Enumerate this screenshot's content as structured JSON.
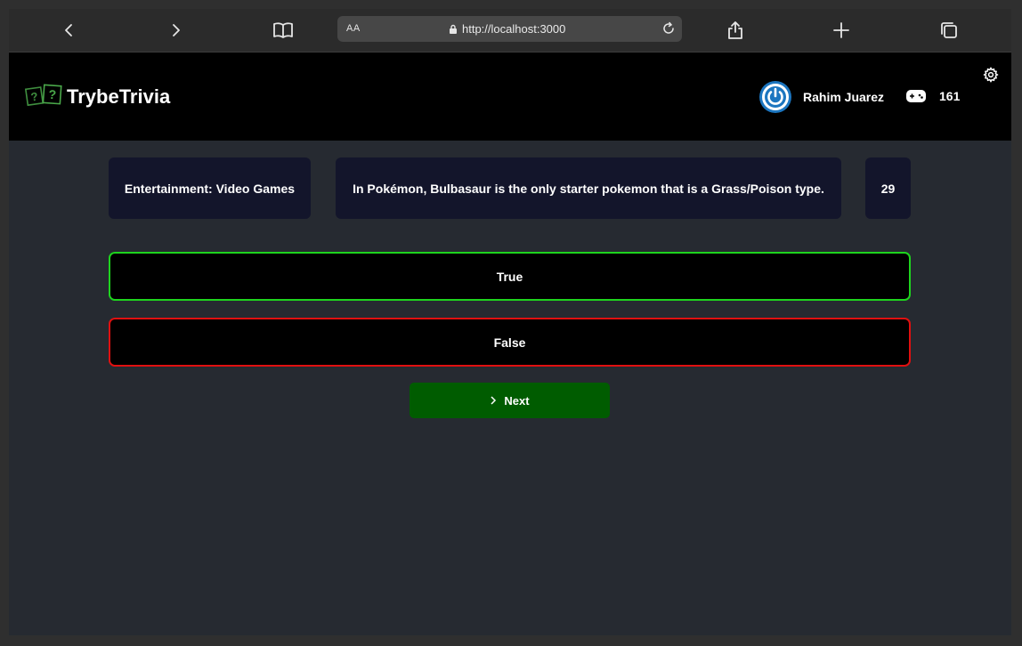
{
  "browser": {
    "url_prefix": "AA",
    "url": "http://localhost:3000"
  },
  "header": {
    "app_name": "TrybeTrivia",
    "player_name": "Rahim Juarez",
    "score": "161"
  },
  "question": {
    "category": "Entertainment: Video Games",
    "text": "In Pokémon, Bulbasaur is the only starter pokemon that is a Grass/Poison type.",
    "timer": "29"
  },
  "answers": [
    {
      "label": "True",
      "status": "correct"
    },
    {
      "label": "False",
      "status": "wrong"
    }
  ],
  "next_label": "Next",
  "colors": {
    "correct": "#1ed41e",
    "wrong": "#e01010",
    "next": "#005c00",
    "card": "#13152b",
    "background": "#262a31"
  }
}
